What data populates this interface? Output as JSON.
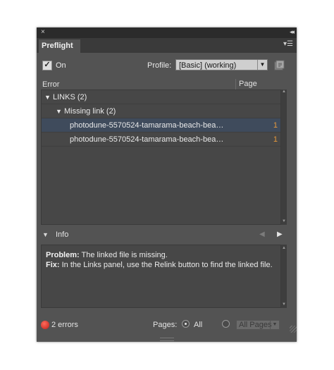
{
  "window": {
    "close_glyph": "×",
    "collapse_glyph": "◂◂",
    "tab_title": "Preflight",
    "menu_glyph": "▾☰"
  },
  "toolbar": {
    "on_checked": true,
    "on_label": "On",
    "profile_label": "Profile:",
    "profile_value": "[Basic] (working)",
    "profile_icon": "profile-definition-icon"
  },
  "list": {
    "col_error": "Error",
    "col_page": "Page",
    "rows": [
      {
        "label": "LINKS (2)",
        "page": "",
        "expanded": true,
        "selected": false
      },
      {
        "label": "Missing link (2)",
        "page": "",
        "expanded": true,
        "selected": false
      },
      {
        "label": "photodune-5570524-tamarama-beach-bea…",
        "page": "1",
        "selected": true
      },
      {
        "label": "photodune-5570524-tamarama-beach-bea…",
        "page": "1",
        "selected": false
      }
    ]
  },
  "info": {
    "label": "Info",
    "problem_label": "Problem:",
    "problem_text": " The linked file is missing.",
    "fix_label": "Fix:",
    "fix_text": " In the Links panel, use the Relink button to find the linked file."
  },
  "footer": {
    "error_count": "2 errors",
    "pages_label": "Pages:",
    "all_label": "All",
    "all_pages_value": "All Pages",
    "selected_option": "All"
  },
  "colors": {
    "panel_bg": "#535353",
    "selection_bg": "#3f4b5c",
    "page_number": "#e89a3c",
    "error_dot": "#d9302a"
  }
}
